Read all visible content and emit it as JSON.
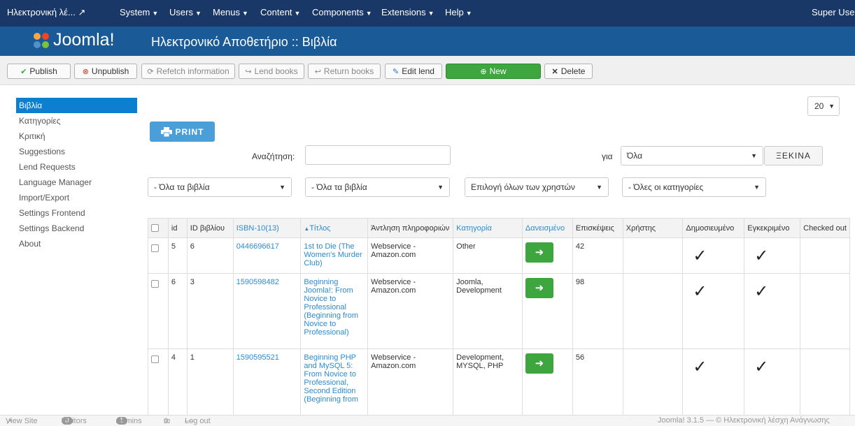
{
  "topbar": {
    "site_name": "Ηλεκτρονική λέ...",
    "site_icon": "external-link-icon",
    "menus": [
      "System",
      "Users",
      "Menus",
      "Content",
      "Components",
      "Extensions",
      "Help"
    ],
    "user": "Super User"
  },
  "header": {
    "logo": "Joomla!",
    "title": "Ηλεκτρονικό Αποθετήριο :: Βιβλία"
  },
  "toolbar": {
    "publish": "Publish",
    "unpublish": "Unpublish",
    "refetch": "Refetch information",
    "lend": "Lend books",
    "return": "Return books",
    "edit_lend": "Edit lend",
    "new": "New",
    "delete": "Delete"
  },
  "sidebar": {
    "items": [
      "Βιβλία",
      "Κατηγορίες",
      "Κριτική",
      "Suggestions",
      "Lend Requests",
      "Language Manager",
      "Import/Export",
      "Settings Frontend",
      "Settings Backend",
      "About"
    ]
  },
  "limit": "20",
  "print_label": "PRINT",
  "search": {
    "label": "Αναζήτηση:",
    "value": "",
    "for_label": "για",
    "for_value": "Όλα",
    "go": "ΞΕΚΙΝΑ"
  },
  "filters": [
    "- Όλα τα βιβλία",
    "- Όλα τα βιβλία",
    "Επιλογή όλων των χρηστών",
    "- Όλες οι κατηγορίες"
  ],
  "table": {
    "headers": [
      "id",
      "ID βιβλίου",
      "ISBN-10(13)",
      "Τίτλος",
      "Άντληση πληροφοριών",
      "Κατηγορία",
      "Δανεισμένο",
      "Επισκέψεις",
      "Χρήστης",
      "Δημοσιευμένο",
      "Εγκεκριμένο",
      "Checked out"
    ],
    "rows": [
      {
        "id": "5",
        "book_id": "6",
        "isbn": "0446696617",
        "title": "1st to Die (The Women's Murder Club)",
        "source": "Webservice - Amazon.com",
        "category": "Other",
        "visits": "42"
      },
      {
        "id": "6",
        "book_id": "3",
        "isbn": "1590598482",
        "title": "Beginning Joomla!: From Novice to Professional (Beginning from Novice to Professional)",
        "source": "Webservice - Amazon.com",
        "category": "Joomla, Development",
        "visits": "98"
      },
      {
        "id": "4",
        "book_id": "1",
        "isbn": "1590595521",
        "title": "Beginning PHP and MySQL 5: From Novice to Professional, Second Edition (Beginning from",
        "source": "Webservice - Amazon.com",
        "category": "Development, MYSQL, PHP",
        "visits": "56"
      }
    ]
  },
  "footer": {
    "view_site": "View Site",
    "visitors_count": "0",
    "visitors": "Visitors",
    "admins_count": "1",
    "admins": "Admins",
    "messages": "0",
    "logout": "Log out",
    "version": "Joomla! 3.1.5 — © Ηλεκτρονική λέσχη Ανάγνωσης"
  }
}
